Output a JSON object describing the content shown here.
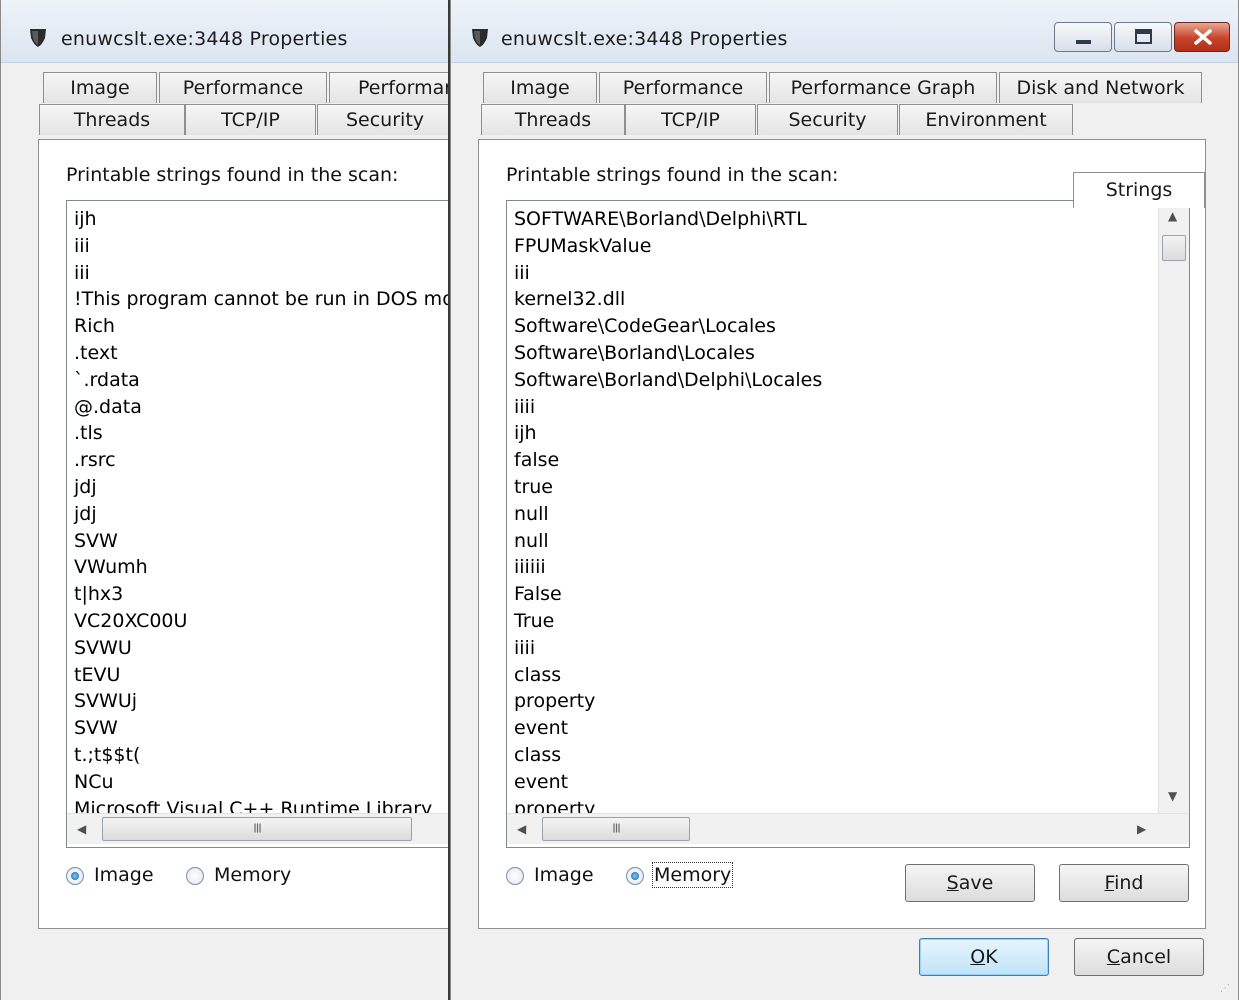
{
  "colors": {
    "window_bg": "#f0f0f0",
    "titlebar": "#dbe5f1",
    "close_button": "#c8432a",
    "default_button": "#bfe3f9"
  },
  "left_window": {
    "title": "enuwcslt.exe:3448 Properties",
    "tabs_row1": [
      "Image",
      "Performance",
      "Performan"
    ],
    "tabs_row2": [
      "Threads",
      "TCP/IP",
      "Security"
    ],
    "label": "Printable strings found in the scan:",
    "strings": [
      "ijh",
      "iii",
      "iii",
      "!This program cannot be run in DOS mode.",
      "Rich",
      ".text",
      "`.rdata",
      "@.data",
      ".tls",
      ".rsrc",
      "jdj",
      "jdj",
      "SVW",
      "VWumh",
      "t|hx3",
      "VC20XC00U",
      "SVWU",
      "tEVU",
      "SVWUj",
      "SVW",
      "t.;t$$t(",
      "NCu",
      "Microsoft Visual C++ Runtime Library"
    ],
    "hscroll_grip": "III",
    "radio_image": "Image",
    "radio_memory": "Memory",
    "selected_radio": "Image"
  },
  "right_window": {
    "title": "enuwcslt.exe:3448 Properties",
    "tabs_row1": [
      "Image",
      "Performance",
      "Performance Graph",
      "Disk and Network"
    ],
    "tabs_row2": [
      "Threads",
      "TCP/IP",
      "Security",
      "Environment",
      "Strings"
    ],
    "active_tab": "Strings",
    "label": "Printable strings found in the scan:",
    "strings": [
      "SOFTWARE\\Borland\\Delphi\\RTL",
      "FPUMaskValue",
      "iii",
      "kernel32.dll",
      "Software\\CodeGear\\Locales",
      "Software\\Borland\\Locales",
      "Software\\Borland\\Delphi\\Locales",
      "iiii",
      "ijh",
      "false",
      "true",
      "null",
      "null",
      "iiiiii",
      "False",
      "True",
      "iiii",
      "class",
      "property",
      "event",
      "class",
      "event",
      "property"
    ],
    "hscroll_grip": "III",
    "radio_image": "Image",
    "radio_memory": "Memory",
    "selected_radio": "Memory",
    "save": {
      "accel": "S",
      "rest": "ave"
    },
    "find": {
      "accel": "F",
      "rest": "ind"
    },
    "ok": {
      "accel": "O",
      "rest": "K"
    },
    "cancel": {
      "accel": "C",
      "rest": "ancel"
    }
  }
}
